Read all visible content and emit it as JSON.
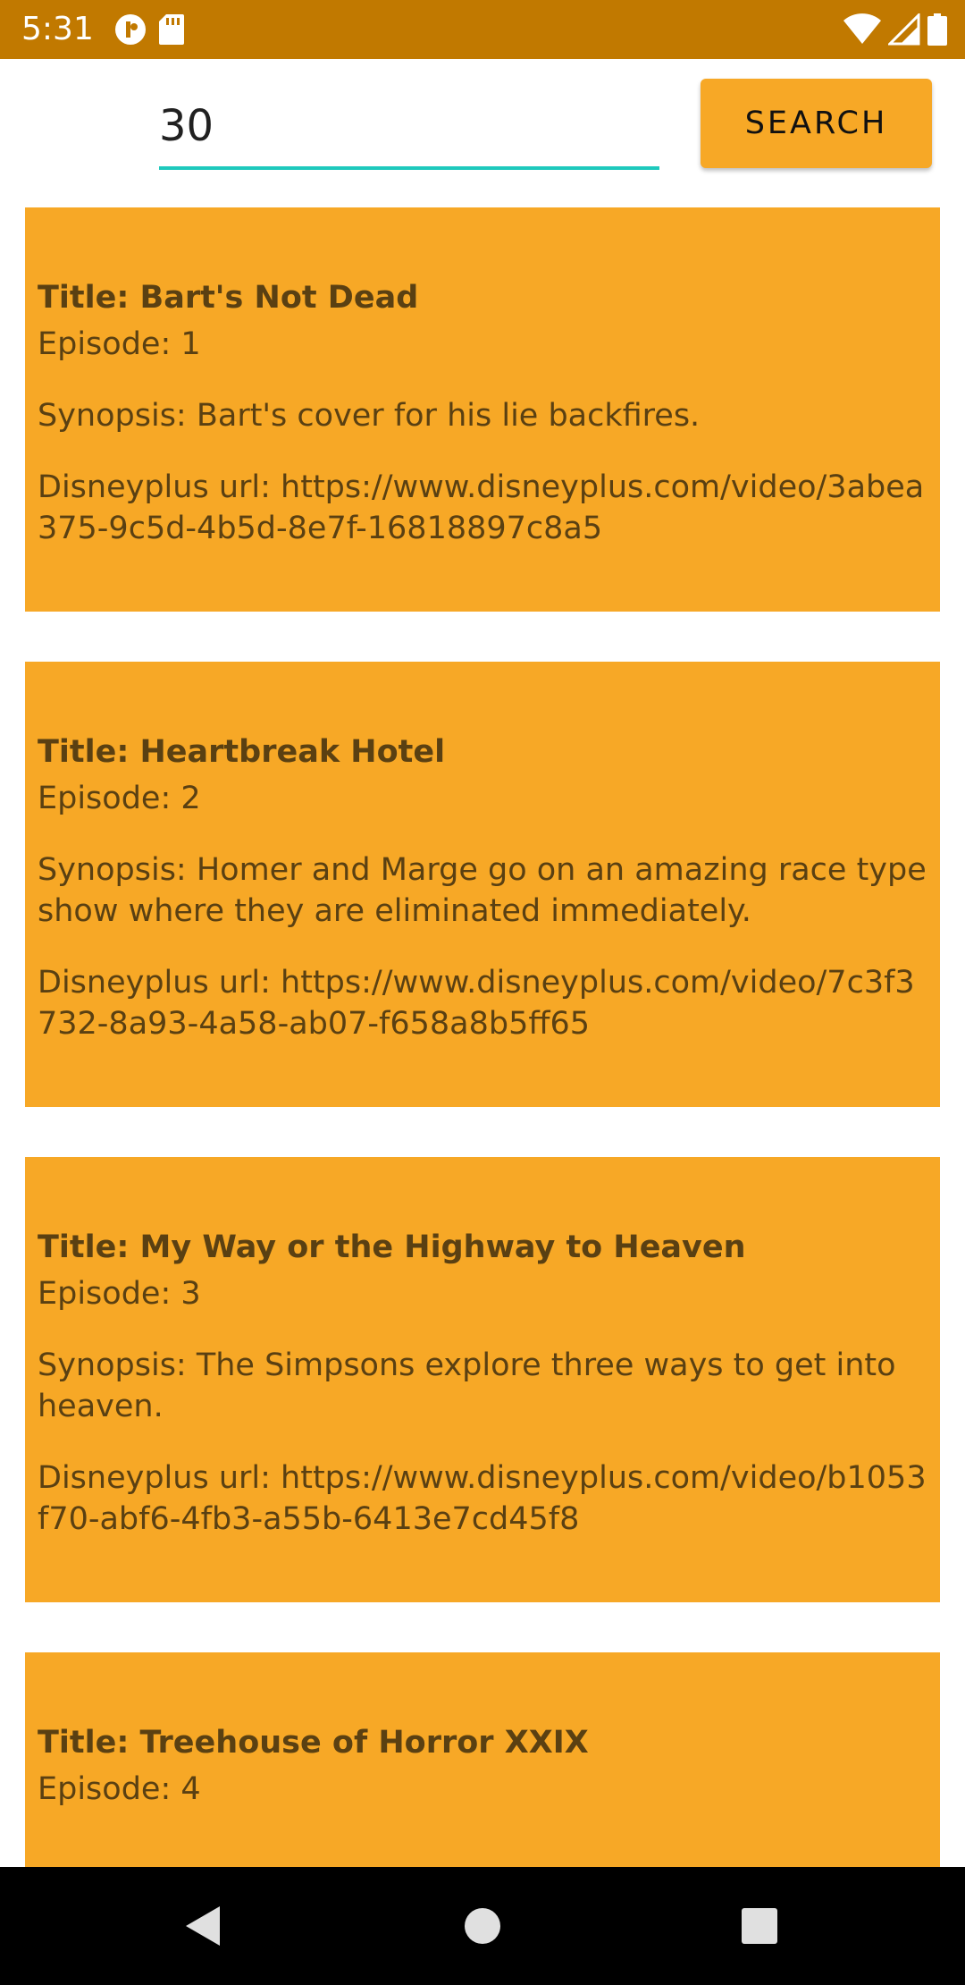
{
  "status_bar": {
    "time": "5:31",
    "left_icons": [
      "circle-badge-icon",
      "sd-card-icon"
    ],
    "right_icons": [
      "wifi-icon",
      "cell-signal-icon",
      "battery-icon"
    ],
    "color": "#c17900"
  },
  "search": {
    "value": "30",
    "button_label": "SEARCH",
    "underline_color": "#1ec9bd",
    "button_color": "#f7a826"
  },
  "episodes": [
    {
      "title": "Title: Bart's Not Dead",
      "episode": "Episode: 1",
      "synopsis": "Synopsis: Bart's cover for his lie backfires.",
      "url": "Disneyplus url: https://www.disneyplus.com/video/3abea375-9c5d-4b5d-8e7f-16818897c8a5"
    },
    {
      "title": "Title: Heartbreak Hotel",
      "episode": "Episode: 2",
      "synopsis": "Synopsis: Homer and Marge go on an amazing race type show where they are eliminated immediately.",
      "url": "Disneyplus url: https://www.disneyplus.com/video/7c3f3732-8a93-4a58-ab07-f658a8b5ff65"
    },
    {
      "title": "Title: My Way or the Highway to Heaven",
      "episode": "Episode: 3",
      "synopsis": "Synopsis: The Simpsons explore three ways to get into heaven.",
      "url": "Disneyplus url: https://www.disneyplus.com/video/b1053f70-abf6-4fb3-a55b-6413e7cd45f8"
    },
    {
      "title": "Title: Treehouse of Horror XXIX",
      "episode": "Episode: 4",
      "synopsis": "",
      "url": ""
    }
  ],
  "card_color": "#f7a826",
  "nav_bar": {
    "icons": [
      "back-icon",
      "home-icon",
      "recents-icon"
    ]
  }
}
